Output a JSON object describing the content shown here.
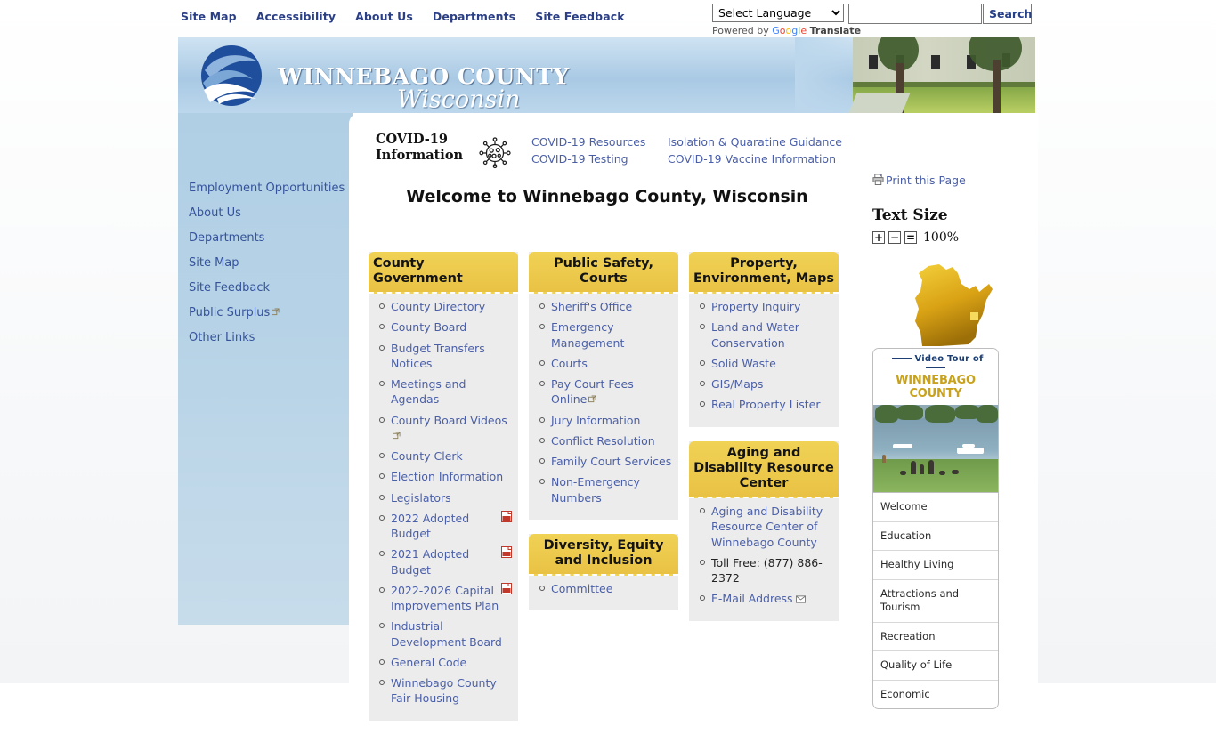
{
  "topnav": {
    "links": [
      "Site Map",
      "Accessibility",
      "About Us",
      "Departments",
      "Site Feedback"
    ]
  },
  "translate": {
    "selected": "Select Language",
    "powered_prefix": "Powered by ",
    "google": "Google",
    "translate_word": "Translate"
  },
  "search": {
    "value": "",
    "placeholder": "",
    "button_label": "Search"
  },
  "masthead": {
    "title": "WINNEBAGO COUNTY",
    "subtitle": "Wisconsin",
    "logo_icon": "winnebago-wave-logo"
  },
  "sidebar": {
    "items": [
      {
        "label": "Employment Opportunities",
        "external": false
      },
      {
        "label": "About Us",
        "external": false
      },
      {
        "label": "Departments",
        "external": false
      },
      {
        "label": "Site Map",
        "external": false
      },
      {
        "label": "Site Feedback",
        "external": false
      },
      {
        "label": "Public Surplus",
        "external": true
      },
      {
        "label": "Other Links",
        "external": false
      }
    ]
  },
  "covid": {
    "title_line1": "COVID-19",
    "title_line2": "Information",
    "icon": "coronavirus-icon",
    "links_col1": [
      "COVID-19 Resources",
      "COVID-19 Testing"
    ],
    "links_col2": [
      "Isolation & Quaratine Guidance",
      "COVID-19 Vaccine Information"
    ]
  },
  "main": {
    "page_title": "Welcome to Winnebago County, Wisconsin"
  },
  "columns": [
    {
      "boxes": [
        {
          "heading": "County Government",
          "heading_align": "left",
          "items": [
            {
              "label": "County Directory"
            },
            {
              "label": "County Board"
            },
            {
              "label": "Budget Transfers Notices"
            },
            {
              "label": "Meetings and Agendas"
            },
            {
              "label": "County Board Videos",
              "external": true
            },
            {
              "label": "County Clerk"
            },
            {
              "label": "Election Information"
            },
            {
              "label": "Legislators"
            },
            {
              "label": "2022 Adopted Budget",
              "pdf": true
            },
            {
              "label": "2021 Adopted Budget",
              "pdf": true
            },
            {
              "label": "2022-2026 Capital Improvements Plan",
              "pdf": true
            },
            {
              "label": "Industrial Development Board"
            },
            {
              "label": "General Code"
            },
            {
              "label": "Winnebago County Fair Housing"
            }
          ]
        }
      ]
    },
    {
      "boxes": [
        {
          "heading": "Public Safety, Courts",
          "items": [
            {
              "label": "Sheriff's Office"
            },
            {
              "label": "Emergency Management"
            },
            {
              "label": "Courts"
            },
            {
              "label": "Pay Court Fees Online",
              "external": true
            },
            {
              "label": "Jury Information"
            },
            {
              "label": "Conflict Resolution"
            },
            {
              "label": "Family Court Services"
            },
            {
              "label": "Non-Emergency Numbers"
            }
          ]
        },
        {
          "heading": "Diversity, Equity and Inclusion",
          "items": [
            {
              "label": "Committee"
            }
          ]
        }
      ]
    },
    {
      "boxes": [
        {
          "heading": "Property, Environment, Maps",
          "items": [
            {
              "label": "Property Inquiry"
            },
            {
              "label": "Land and Water Conservation"
            },
            {
              "label": "Solid Waste"
            },
            {
              "label": "GIS/Maps"
            },
            {
              "label": "Real Property Lister"
            }
          ]
        },
        {
          "heading": "Aging and Disability Resource Center",
          "items": [
            {
              "label": "Aging and Disability Resource Center of Winnebago County"
            },
            {
              "label": "Toll Free: (877) 886-2372",
              "plain": true
            },
            {
              "label": "E-Mail Address",
              "mail": true
            }
          ]
        }
      ]
    }
  ],
  "rightrail": {
    "print_label": "Print this Page",
    "print_icon": "printer-icon",
    "text_size_heading": "Text Size",
    "ts_increase": "+",
    "ts_decrease": "−",
    "ts_reset": "=",
    "ts_percent": "100%",
    "map_icon": "wisconsin-state-map",
    "video": {
      "line1": "Video Tour of",
      "line2": "WINNEBAGO COUNTY",
      "photo_alt": "lake-shoreline-photo",
      "menu": [
        "Welcome",
        "Education",
        "Healthy Living",
        "Attractions and Tourism",
        "Recreation",
        "Quality of Life",
        "Economic"
      ]
    }
  },
  "colors": {
    "link": "#4a5fa8",
    "topnav_link": "#2b3f86",
    "box_header_gold": "#e9c244",
    "box_body_gray": "#ececec",
    "rail_blue": "#b6d2e6",
    "map_gold": "#d6a517"
  }
}
